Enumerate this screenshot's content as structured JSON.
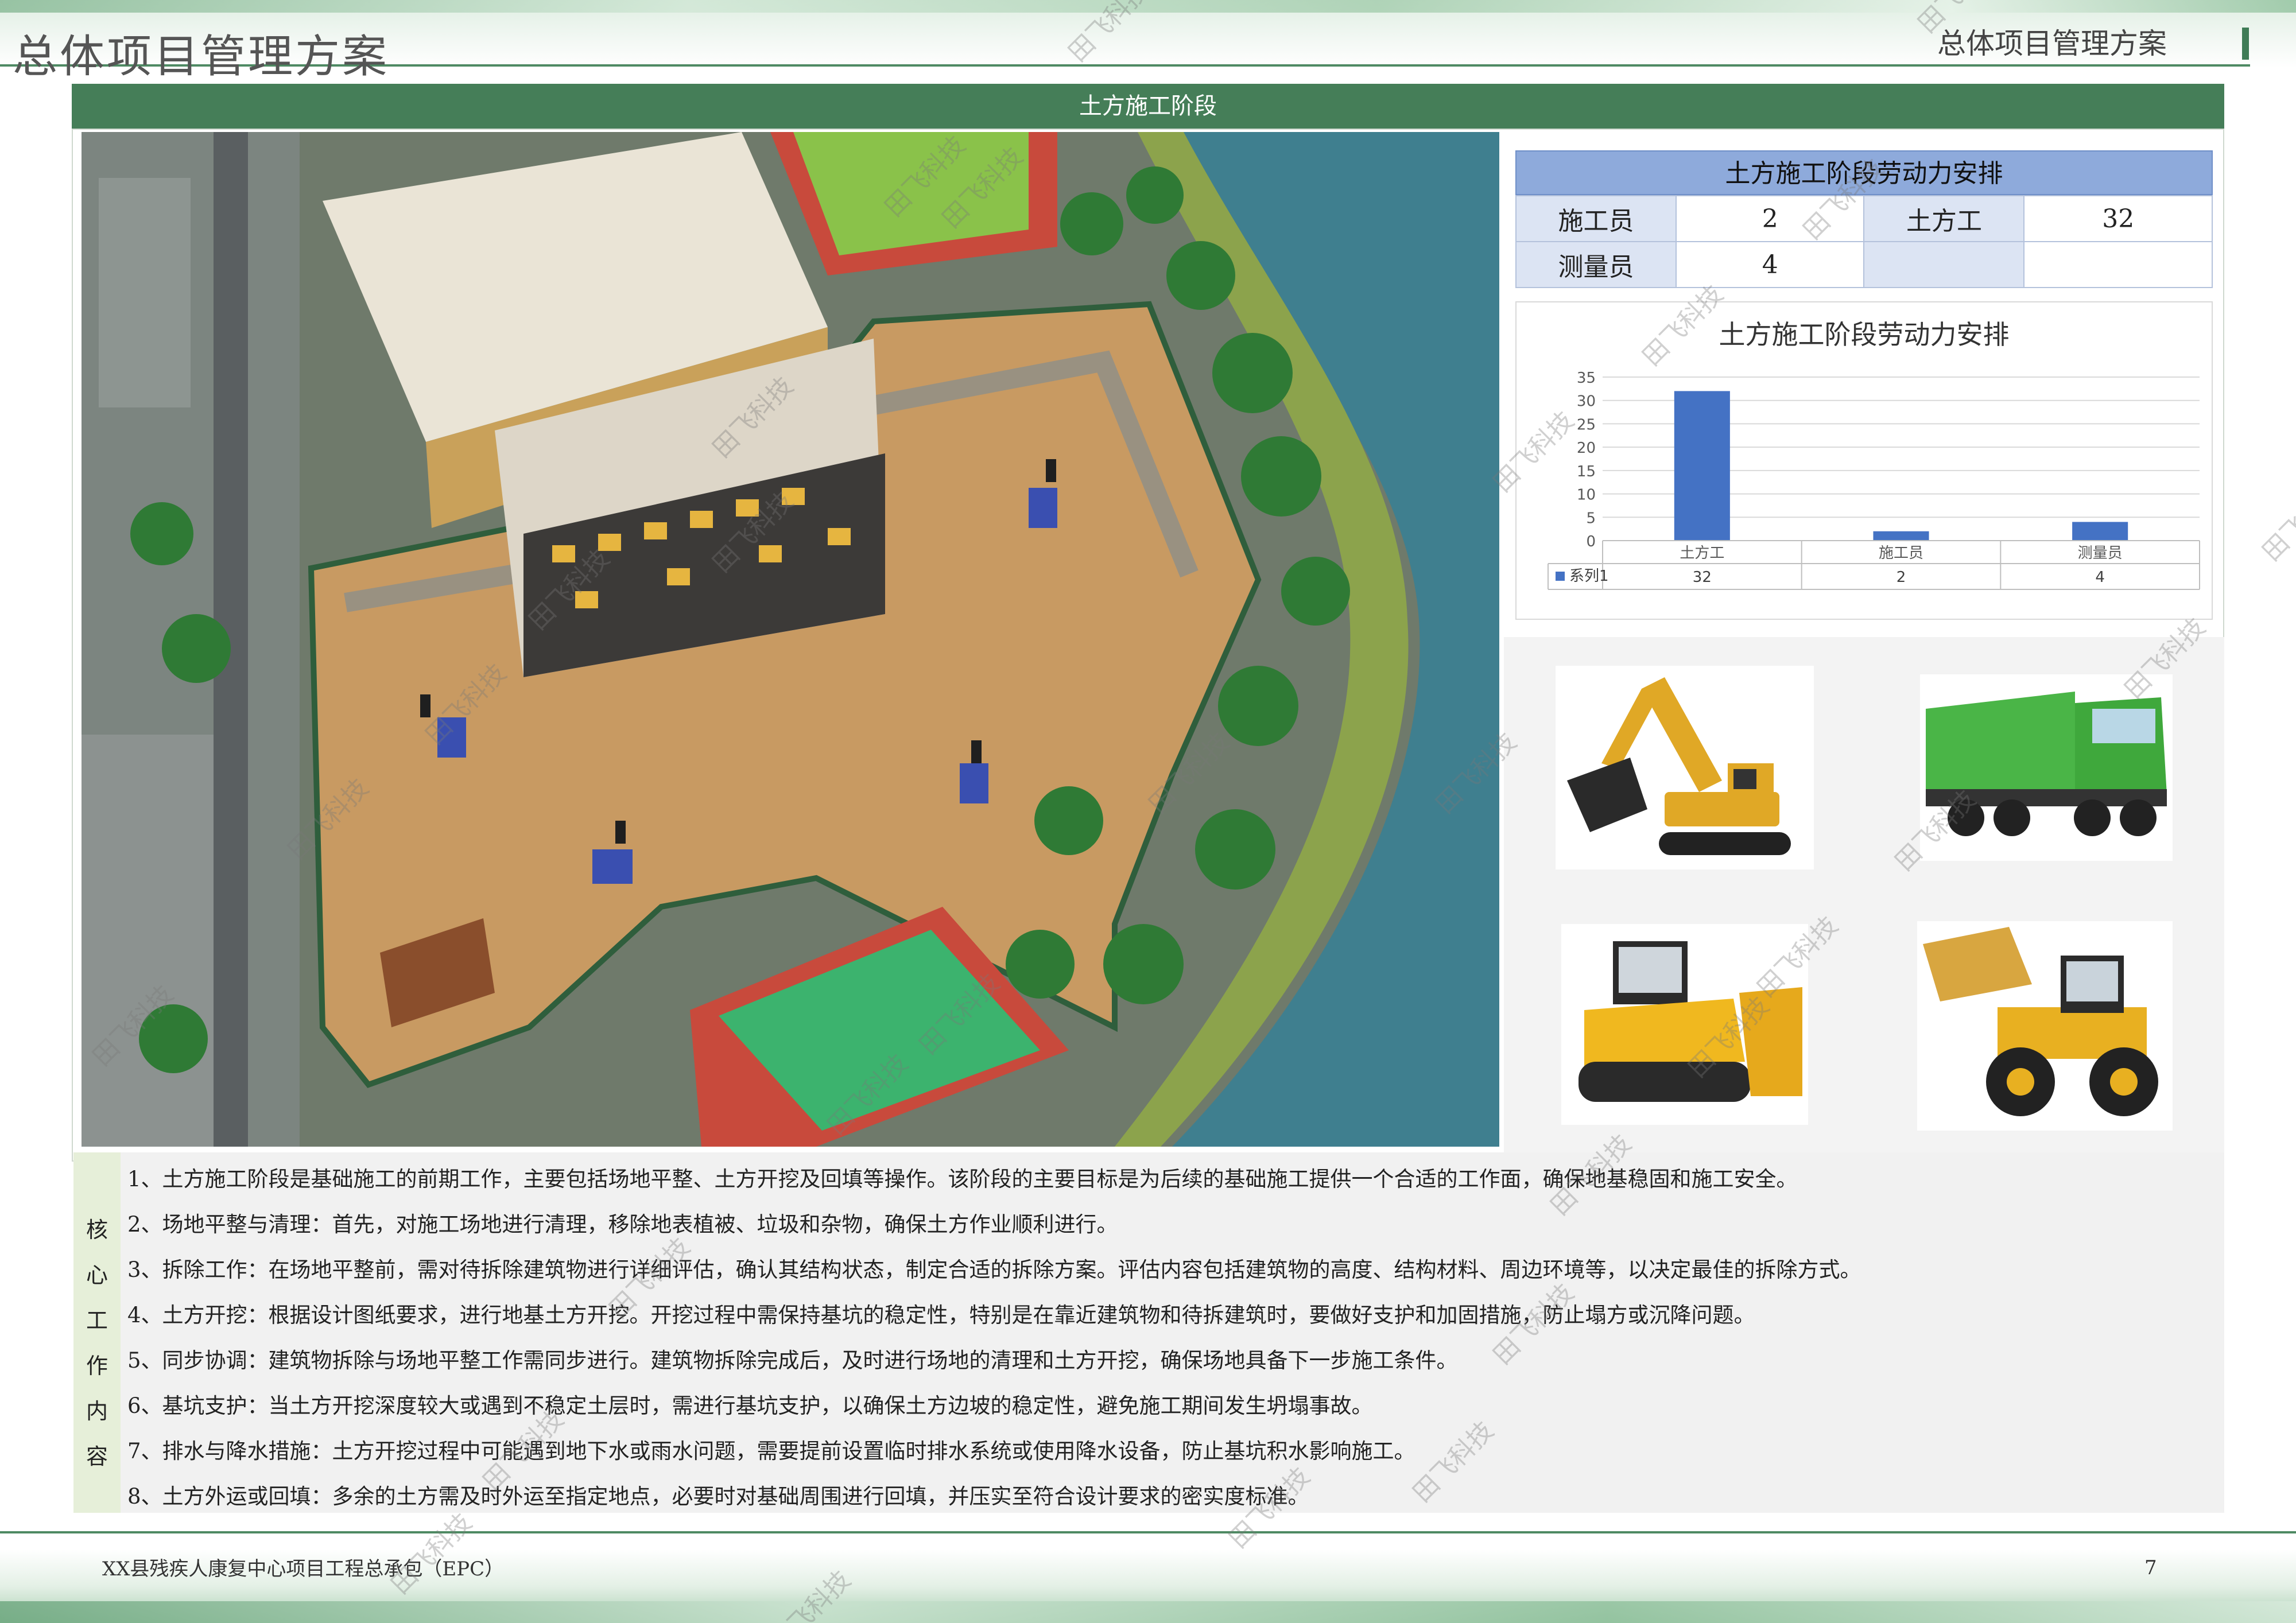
{
  "header": {
    "title_left": "总体项目管理方案",
    "title_right": "总体项目管理方案"
  },
  "section": {
    "title": "土方施工阶段"
  },
  "labor_table": {
    "title": "土方施工阶段劳动力安排",
    "rows": [
      [
        {
          "label": "施工员",
          "value": "2"
        },
        {
          "label": "土方工",
          "value": "32"
        }
      ],
      [
        {
          "label": "测量员",
          "value": "4"
        },
        {
          "label": "",
          "value": ""
        }
      ]
    ]
  },
  "chart_data": {
    "type": "bar",
    "title": "土方施工阶段劳动力安排",
    "categories": [
      "土方工",
      "施工员",
      "测量员"
    ],
    "series": [
      {
        "name": "系列1",
        "values": [
          32,
          2,
          4
        ],
        "color": "#4472c4"
      }
    ],
    "ylim": [
      0,
      35
    ],
    "yticks": [
      0,
      5,
      10,
      15,
      20,
      25,
      30,
      35
    ],
    "grid": true,
    "legend": "data-table-bottom"
  },
  "equipment": [
    "excavator-photo",
    "dump-truck-photo",
    "bulldozer-photo",
    "wheel-loader-photo"
  ],
  "core_work": {
    "label_chars": [
      "核",
      "心",
      "工",
      "作",
      "内",
      "容"
    ],
    "items": [
      "1、土方施工阶段是基础施工的前期工作，主要包括场地平整、土方开挖及回填等操作。该阶段的主要目标是为后续的基础施工提供一个合适的工作面，确保地基稳固和施工安全。",
      "2、场地平整与清理：首先，对施工场地进行清理，移除地表植被、垃圾和杂物，确保土方作业顺利进行。",
      "3、拆除工作：在场地平整前，需对待拆除建筑物进行详细评估，确认其结构状态，制定合适的拆除方案。评估内容包括建筑物的高度、结构材料、周边环境等，以决定最佳的拆除方式。",
      "4、土方开挖：根据设计图纸要求，进行地基土方开挖。开挖过程中需保持基坑的稳定性，特别是在靠近建筑物和待拆建筑时，要做好支护和加固措施，防止塌方或沉降问题。",
      "5、同步协调：建筑物拆除与场地平整工作需同步进行。建筑物拆除完成后，及时进行场地的清理和土方开挖，确保场地具备下一步施工条件。",
      "6、基坑支护：当土方开挖深度较大或遇到不稳定土层时，需进行基坑支护，以确保土方边坡的稳定性，避免施工期间发生坍塌事故。",
      "7、排水与降水措施：土方开挖过程中可能遇到地下水或雨水问题，需要提前设置临时排水系统或使用降水设备，防止基坑积水影响施工。",
      "8、土方外运或回填：多余的土方需及时外运至指定地点，必要时对基础周围进行回填，并压实至符合设计要求的密实度标准。"
    ]
  },
  "footer": {
    "project": "XX县残疾人康复中心项目工程总承包（EPC）",
    "page": "7"
  },
  "watermark": "田飞科技"
}
